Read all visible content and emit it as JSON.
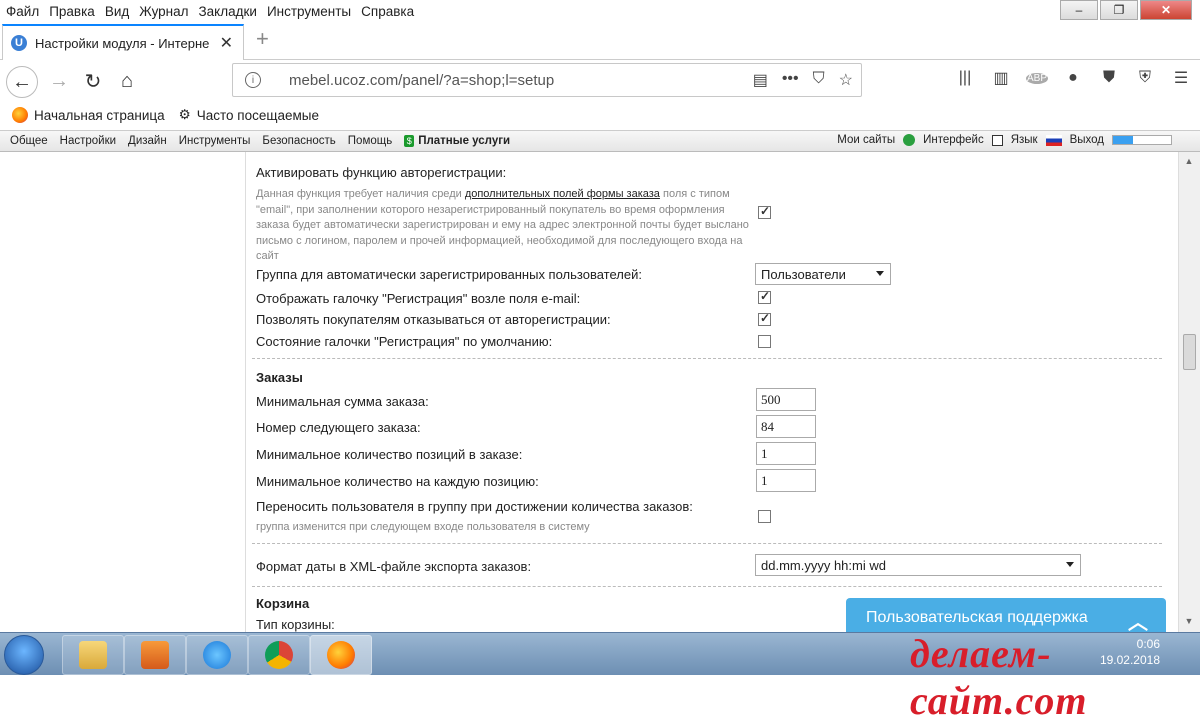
{
  "menu": [
    "Файл",
    "Правка",
    "Вид",
    "Журнал",
    "Закладки",
    "Инструменты",
    "Справка"
  ],
  "tab": {
    "favicon": "U",
    "title": "Настройки модуля - Интерне"
  },
  "url": {
    "host": "mebel.ucoz.com",
    "path": "/panel/?a=shop;l=setup"
  },
  "bookmarks": {
    "home": "Начальная страница",
    "frequent": "Часто посещаемые"
  },
  "ucozbar": {
    "items": [
      "Общее",
      "Настройки",
      "Дизайн",
      "Инструменты",
      "Безопасность",
      "Помощь"
    ],
    "paid": "Платные услуги",
    "mysites": "Мои сайты",
    "interface": "Интерфейс",
    "language": "Язык",
    "logout": "Выход",
    "progress": 0.35
  },
  "form": {
    "autoreg_label": "Активировать функцию авторегистрации:",
    "autoreg_desc_1": "Данная функция требует наличия среди ",
    "autoreg_desc_link": "дополнительных полей формы заказа",
    "autoreg_desc_2": " поля с типом \"email\", при заполнении которого незарегистрированный покупатель во время оформления заказа будет автоматически зарегистрирован и ему на адрес электронной почты будет выслано письмо с логином, паролем и прочей информацией, необходимой для последующего входа на сайт",
    "autoreg_checked": true,
    "group_label": "Группа для автоматически зарегистрированных пользователей:",
    "group_value": "Пользователи",
    "show_reg_label": "Отображать галочку \"Регистрация\" возле поля e-mail:",
    "show_reg_checked": true,
    "allow_refuse_label": "Позволять покупателям отказываться от авторегистрации:",
    "allow_refuse_checked": true,
    "default_state_label": "Состояние галочки \"Регистрация\" по умолчанию:",
    "default_state_checked": false,
    "orders_head": "Заказы",
    "min_sum_label": "Минимальная сумма заказа:",
    "min_sum_value": "500",
    "next_num_label": "Номер следующего заказа:",
    "next_num_value": "84",
    "min_pos_label": "Минимальное количество позиций в заказе:",
    "min_pos_value": "1",
    "min_each_label": "Минимальное количество на каждую позицию:",
    "min_each_value": "1",
    "move_group_label": "Переносить пользователя в группу при достижении количества заказов:",
    "move_group_desc": "группа изменится при следующем входе пользователя в систему",
    "move_group_checked": false,
    "date_format_label": "Формат даты в XML-файле экспорта заказов:",
    "date_format_value": "dd.mm.yyyy hh:mi wd",
    "cart_head": "Корзина",
    "cart_type_label": "Тип корзины:"
  },
  "support": "Пользовательская поддержка",
  "watermark": "делаем-сайт.com",
  "clock": {
    "time": "0:06",
    "date": "19.02.2018"
  }
}
